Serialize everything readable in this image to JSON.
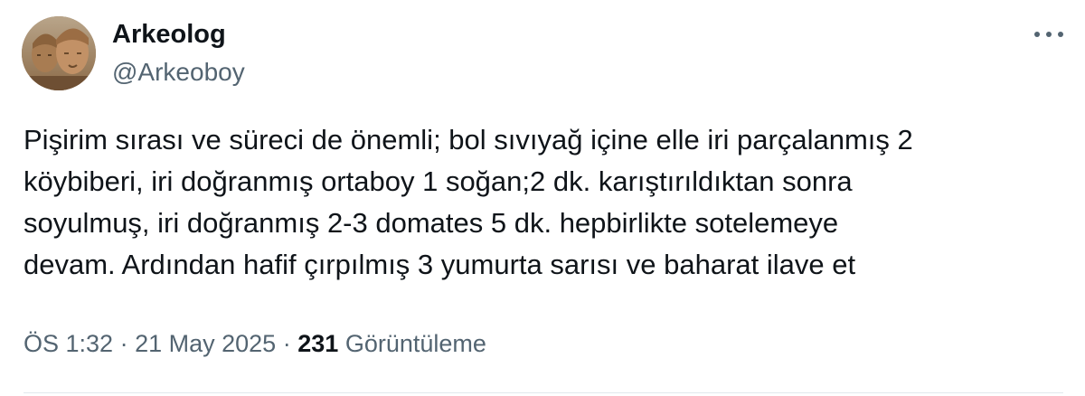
{
  "author": {
    "name": "Arkeolog",
    "handle": "@Arkeoboy",
    "avatar_icon": "stone-statue-heads-avatar"
  },
  "menu_icon": "more-horizontal-icon",
  "tweet": {
    "lines": [
      "Pişirim sırası ve süreci de önemli; bol sıvıyağ içine elle iri parçalanmış 2",
      "köybiberi, iri doğranmış ortaboy 1 soğan;2 dk. karıştırıldıktan sonra",
      "soyulmuş, iri doğranmış 2-3 domates 5 dk. hepbirlikte sotelemeye",
      "devam. Ardından hafif çırpılmış 3 yumurta sarısı ve baharat ilave et"
    ]
  },
  "meta": {
    "time": "ÖS 1:32",
    "separator": "·",
    "date": "21 May 2025",
    "views_count": "231",
    "views_label": "Görüntüleme"
  },
  "colors": {
    "text_primary": "#0f1419",
    "text_secondary": "#536471",
    "divider": "#e1e8ed"
  }
}
